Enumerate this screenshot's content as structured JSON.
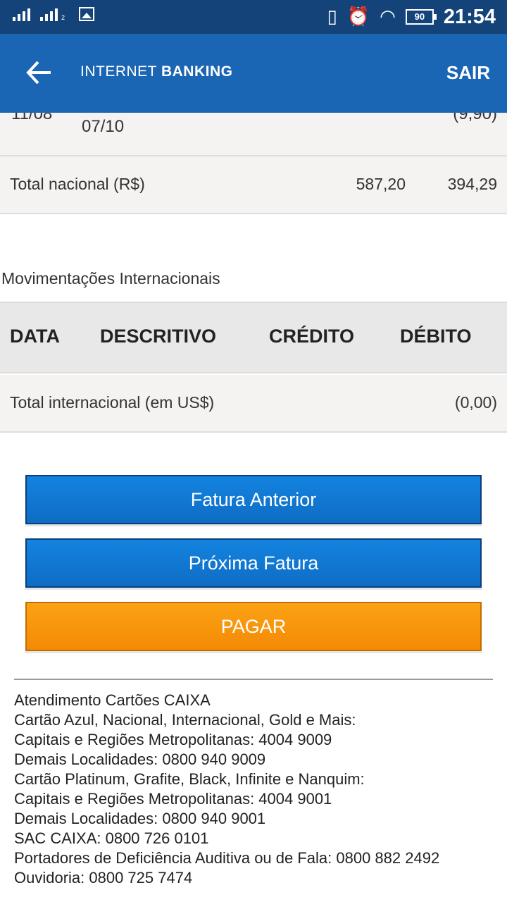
{
  "status_bar": {
    "sim2_label": "2",
    "battery": "90",
    "time": "21:54",
    "icons": [
      "signal-icon",
      "gallery-icon",
      "vibrate-icon",
      "alarm-icon",
      "wifi-icon",
      "battery-icon"
    ]
  },
  "app_bar": {
    "brand_light": "INTERNET",
    "brand_bold": "BANKING",
    "logout_label": "SAIR",
    "accent": "#1a65b4"
  },
  "national": {
    "partial_row": {
      "date": "11/08",
      "description": "07/10",
      "value": "(9,90)"
    },
    "total": {
      "label": "Total nacional (R$)",
      "credit": "587,20",
      "debit": "394,29"
    }
  },
  "international": {
    "title": "Movimentações Internacionais",
    "headers": [
      "DATA",
      "DESCRITIVO",
      "CRÉDITO",
      "DÉBITO"
    ],
    "total": {
      "label": "Total internacional (em US$)",
      "debit": "(0,00)"
    }
  },
  "buttons": {
    "previous": "Fatura Anterior",
    "next": "Próxima Fatura",
    "pay": "PAGAR",
    "blue": "#1384e0",
    "orange": "#fca214"
  },
  "footer": {
    "lines": [
      "Atendimento Cartões CAIXA",
      "Cartão Azul, Nacional, Internacional, Gold e Mais:",
      "Capitais e Regiões Metropolitanas: 4004 9009",
      "Demais Localidades: 0800 940 9009",
      "Cartão Platinum, Grafite, Black, Infinite e Nanquim:",
      "Capitais e Regiões Metropolitanas: 4004 9001",
      "Demais Localidades: 0800 940 9001",
      "SAC CAIXA: 0800 726 0101",
      "Portadores de Deficiência Auditiva ou de Fala: 0800 882 2492",
      "Ouvidoria: 0800 725 7474"
    ]
  }
}
